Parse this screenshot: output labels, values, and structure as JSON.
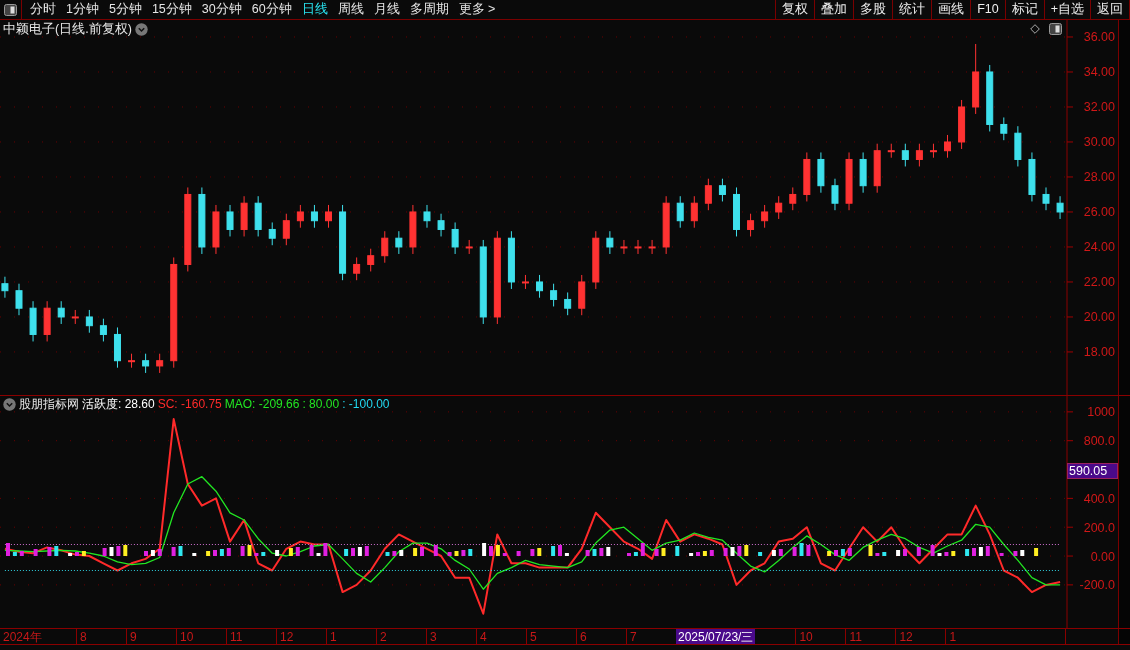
{
  "toolbar": {
    "periods": [
      {
        "label": "分时",
        "selected": false
      },
      {
        "label": "1分钟",
        "selected": false
      },
      {
        "label": "5分钟",
        "selected": false
      },
      {
        "label": "15分钟",
        "selected": false
      },
      {
        "label": "30分钟",
        "selected": false
      },
      {
        "label": "60分钟",
        "selected": false
      },
      {
        "label": "日线",
        "selected": true
      },
      {
        "label": "周线",
        "selected": false
      },
      {
        "label": "月线",
        "selected": false
      },
      {
        "label": "多周期",
        "selected": false
      },
      {
        "label": "更多 >",
        "selected": false
      }
    ],
    "actions": [
      "复权",
      "叠加",
      "多股",
      "统计",
      "画线",
      "F10",
      "标记",
      "+自选",
      "返回"
    ]
  },
  "price_panel": {
    "title": "中颖电子(日线.前复权)",
    "chart_data": {
      "type": "candlestick",
      "categories": [
        null,
        null,
        null,
        null,
        null,
        null,
        null,
        null,
        null,
        null,
        null,
        null,
        null,
        null,
        null,
        null,
        null,
        null,
        null,
        null,
        null,
        null,
        null,
        null,
        null,
        null,
        null,
        null,
        null,
        null,
        null,
        null,
        null,
        null,
        null,
        null,
        null,
        null,
        null,
        null,
        null,
        null,
        null,
        null,
        null,
        null,
        null,
        null,
        null,
        null,
        null,
        null,
        null,
        null,
        null,
        null,
        null,
        null,
        null,
        null,
        null,
        null,
        null,
        null,
        null,
        null,
        null,
        null,
        null,
        null,
        null,
        null,
        null,
        null,
        null,
        null
      ],
      "ohlc": [
        [
          21.9,
          22.3,
          21.1,
          21.5
        ],
        [
          21.5,
          21.9,
          20.1,
          20.5
        ],
        [
          20.5,
          20.9,
          18.6,
          19
        ],
        [
          19,
          20.9,
          18.6,
          20.5
        ],
        [
          20.5,
          20.9,
          19.6,
          20
        ],
        [
          20,
          20.4,
          19.6,
          20
        ],
        [
          20,
          20.4,
          19.1,
          19.5
        ],
        [
          19.5,
          19.9,
          18.6,
          19
        ],
        [
          19,
          19.4,
          17.1,
          17.5
        ],
        [
          17.5,
          17.9,
          17.1,
          17.5
        ],
        [
          17.5,
          17.9,
          16.8,
          17.2
        ],
        [
          17.2,
          17.9,
          16.8,
          17.5
        ],
        [
          17.5,
          23.4,
          17.1,
          23
        ],
        [
          23,
          27.4,
          22.6,
          27
        ],
        [
          27,
          27.4,
          23.6,
          24
        ],
        [
          24,
          26.4,
          23.6,
          26
        ],
        [
          26,
          26.4,
          24.6,
          25
        ],
        [
          25,
          26.9,
          24.6,
          26.5
        ],
        [
          26.5,
          26.9,
          24.6,
          25
        ],
        [
          25,
          25.4,
          24.1,
          24.5
        ],
        [
          24.5,
          25.9,
          24.1,
          25.5
        ],
        [
          25.5,
          26.4,
          25.1,
          26
        ],
        [
          26,
          26.4,
          25.1,
          25.5
        ],
        [
          25.5,
          26.4,
          25.1,
          26
        ],
        [
          26,
          26.4,
          22.1,
          22.5
        ],
        [
          22.5,
          23.4,
          22.1,
          23
        ],
        [
          23,
          23.9,
          22.6,
          23.5
        ],
        [
          23.5,
          24.9,
          23.1,
          24.5
        ],
        [
          24.5,
          24.9,
          23.6,
          24
        ],
        [
          24,
          26.4,
          23.6,
          26
        ],
        [
          26,
          26.4,
          25.1,
          25.5
        ],
        [
          25.5,
          25.9,
          24.6,
          25
        ],
        [
          25,
          25.4,
          23.6,
          24
        ],
        [
          24,
          24.4,
          23.6,
          24
        ],
        [
          24,
          24.4,
          19.6,
          20
        ],
        [
          20,
          24.9,
          19.6,
          24.5
        ],
        [
          24.5,
          24.9,
          21.6,
          22
        ],
        [
          22,
          22.4,
          21.6,
          22
        ],
        [
          22,
          22.4,
          21.1,
          21.5
        ],
        [
          21.5,
          21.9,
          20.6,
          21
        ],
        [
          21,
          21.4,
          20.1,
          20.5
        ],
        [
          20.5,
          22.4,
          20.1,
          22
        ],
        [
          22,
          24.9,
          21.6,
          24.5
        ],
        [
          24.5,
          24.9,
          23.6,
          24
        ],
        [
          24,
          24.4,
          23.6,
          24
        ],
        [
          24,
          24.4,
          23.6,
          24
        ],
        [
          24,
          24.4,
          23.6,
          24
        ],
        [
          24,
          26.9,
          23.6,
          26.5
        ],
        [
          26.5,
          26.9,
          25.1,
          25.5
        ],
        [
          25.5,
          26.9,
          25.1,
          26.5
        ],
        [
          26.5,
          27.9,
          26.1,
          27.5
        ],
        [
          27.5,
          27.9,
          26.6,
          27
        ],
        [
          27,
          27.4,
          24.6,
          25
        ],
        [
          25,
          25.9,
          24.6,
          25.5
        ],
        [
          25.5,
          26.4,
          25.1,
          26
        ],
        [
          26,
          26.9,
          25.6,
          26.5
        ],
        [
          26.5,
          27.4,
          26.1,
          27
        ],
        [
          27,
          29.4,
          26.6,
          29
        ],
        [
          29,
          29.4,
          27.1,
          27.5
        ],
        [
          27.5,
          27.9,
          26.1,
          26.5
        ],
        [
          26.5,
          29.4,
          26.1,
          29
        ],
        [
          29,
          29.4,
          27.1,
          27.5
        ],
        [
          27.5,
          29.9,
          27.1,
          29.5
        ],
        [
          29.5,
          29.9,
          29.1,
          29.5
        ],
        [
          29.5,
          29.9,
          28.6,
          29
        ],
        [
          29,
          29.9,
          28.6,
          29.5
        ],
        [
          29.5,
          29.9,
          29.1,
          29.5
        ],
        [
          29.5,
          30.4,
          29.1,
          30
        ],
        [
          30,
          32.4,
          29.6,
          32
        ],
        [
          32,
          35.6,
          31.6,
          34
        ],
        [
          34,
          34.4,
          30.6,
          31
        ],
        [
          31,
          31.4,
          30.1,
          30.5
        ],
        [
          30.5,
          30.9,
          28.6,
          29
        ],
        [
          29,
          29.4,
          26.6,
          27
        ],
        [
          27,
          27.4,
          26.1,
          26.5
        ],
        [
          26.5,
          26.9,
          25.6,
          26
        ]
      ],
      "ylim": [
        15.54,
        36.97
      ],
      "grid": true,
      "yticks": [
        {
          "value": 18,
          "label": "18.00"
        },
        {
          "value": 20,
          "label": "20.00"
        },
        {
          "value": 22,
          "label": "22.00"
        },
        {
          "value": 24,
          "label": "24.00"
        },
        {
          "value": 26,
          "label": "26.00"
        },
        {
          "value": 28,
          "label": "28.00"
        },
        {
          "value": 30,
          "label": "30.00"
        },
        {
          "value": 32,
          "label": "32.00"
        },
        {
          "value": 34,
          "label": "34.00"
        },
        {
          "value": 36,
          "label": "36.00"
        }
      ]
    }
  },
  "indicator_panel": {
    "name": "股朋指标网",
    "readouts": [
      {
        "text": "活跃度: 28.60",
        "color": "#ffffff"
      },
      {
        "text": "SC: -160.75",
        "color": "#ff2a2a"
      },
      {
        "text": "MAO: -209.66",
        "color": "#22e622"
      },
      {
        "text": ": 80.00",
        "color": "#22e622"
      },
      {
        "text": ": -100.00",
        "color": "#22d8f0"
      }
    ],
    "chart_data": {
      "type": "line",
      "categories": [
        null,
        null,
        null,
        null,
        null,
        null,
        null,
        null,
        null,
        null,
        null,
        null,
        null,
        null,
        null,
        null,
        null,
        null,
        null,
        null,
        null,
        null,
        null,
        null,
        null,
        null,
        null,
        null,
        null,
        null,
        null,
        null,
        null,
        null,
        null,
        null,
        null,
        null,
        null,
        null,
        null,
        null,
        null,
        null,
        null,
        null,
        null,
        null,
        null,
        null,
        null,
        null,
        null,
        null,
        null,
        null,
        null,
        null,
        null,
        null,
        null,
        null,
        null,
        null,
        null,
        null,
        null,
        null,
        null,
        null,
        null,
        null,
        null,
        null,
        null,
        null
      ],
      "series": [
        {
          "color": "#ff2a2a",
          "values": [
            50,
            30,
            20,
            60,
            40,
            10,
            0,
            -50,
            -100,
            -50,
            -20,
            50,
            950,
            500,
            350,
            400,
            100,
            250,
            -50,
            -100,
            50,
            100,
            80,
            80,
            -250,
            -200,
            -100,
            50,
            150,
            100,
            50,
            0,
            -150,
            -150,
            -400,
            150,
            -50,
            -50,
            -80,
            -80,
            -80,
            50,
            300,
            200,
            100,
            50,
            -20,
            250,
            100,
            150,
            120,
            80,
            -200,
            -100,
            -50,
            100,
            120,
            200,
            -50,
            -100,
            50,
            200,
            100,
            200,
            50,
            -50,
            50,
            150,
            150,
            350,
            150,
            -100,
            -150,
            -250,
            -200,
            -180
          ]
        },
        {
          "color": "#22e622",
          "values": [
            40,
            35,
            30,
            35,
            40,
            35,
            20,
            0,
            -40,
            -60,
            -50,
            -10,
            300,
            500,
            550,
            450,
            300,
            250,
            120,
            20,
            0,
            30,
            70,
            80,
            -20,
            -120,
            -180,
            -80,
            30,
            90,
            90,
            50,
            -30,
            -90,
            -230,
            -120,
            -80,
            -30,
            -60,
            -70,
            -80,
            -40,
            90,
            180,
            200,
            120,
            40,
            90,
            110,
            160,
            130,
            110,
            20,
            -70,
            -110,
            -30,
            60,
            140,
            80,
            10,
            -30,
            60,
            110,
            150,
            120,
            60,
            20,
            70,
            110,
            220,
            200,
            80,
            -30,
            -150,
            -200,
            -200
          ]
        },
        {
          "color": "#d070d0",
          "line_style": "dotted",
          "values": [
            80,
            80,
            80,
            80,
            80,
            80,
            80,
            80,
            80,
            80,
            80,
            80,
            80,
            80,
            80,
            80,
            80,
            80,
            80,
            80,
            80,
            80,
            80,
            80,
            80,
            80,
            80,
            80,
            80,
            80,
            80,
            80,
            80,
            80,
            80,
            80,
            80,
            80,
            80,
            80,
            80,
            80,
            80,
            80,
            80,
            80,
            80,
            80,
            80,
            80,
            80,
            80,
            80,
            80,
            80,
            80,
            80,
            80,
            80,
            80,
            80,
            80,
            80,
            80,
            80,
            80,
            80,
            80,
            80,
            80,
            80,
            80,
            80,
            80,
            80,
            80
          ]
        },
        {
          "color": "#30d0e0",
          "line_style": "dotted",
          "values": [
            -100,
            -100,
            -100,
            -100,
            -100,
            -100,
            -100,
            -100,
            -100,
            -100,
            -100,
            -100,
            -100,
            -100,
            -100,
            -100,
            -100,
            -100,
            -100,
            -100,
            -100,
            -100,
            -100,
            -100,
            -100,
            -100,
            -100,
            -100,
            -100,
            -100,
            -100,
            -100,
            -100,
            -100,
            -100,
            -100,
            -100,
            -100,
            -100,
            -100,
            -100,
            -100,
            -100,
            -100,
            -100,
            -100,
            -100,
            -100,
            -100,
            -100,
            -100,
            -100,
            -100,
            -100,
            -100,
            -100,
            -100,
            -100,
            -100,
            -100,
            -100,
            -100,
            -100,
            -100,
            -100,
            -100,
            -100,
            -100,
            -100,
            -100,
            -100,
            -100,
            -100,
            -100,
            -100,
            -100
          ]
        }
      ],
      "ylim": [
        -499,
        1110
      ],
      "yticks": [
        {
          "value": -200,
          "label": "-200.0"
        },
        {
          "value": 0,
          "label": "0.00"
        },
        {
          "value": 200,
          "label": "200.0"
        },
        {
          "value": 400,
          "label": "400.0"
        },
        {
          "value": 800,
          "label": "800.0"
        },
        {
          "value": 1000,
          "label": "1000"
        }
      ],
      "grid": true
    },
    "cursor_value": "590.05"
  },
  "time_axis": [
    {
      "label": "2024年",
      "selected": false
    },
    {
      "label": "8",
      "selected": false
    },
    {
      "label": "9",
      "selected": false
    },
    {
      "label": "10",
      "selected": false
    },
    {
      "label": "11",
      "selected": false
    },
    {
      "label": "12",
      "selected": false
    },
    {
      "label": "1",
      "selected": false
    },
    {
      "label": "2",
      "selected": false
    },
    {
      "label": "3",
      "selected": false
    },
    {
      "label": "4",
      "selected": false
    },
    {
      "label": "5",
      "selected": false
    },
    {
      "label": "6",
      "selected": false
    },
    {
      "label": "7",
      "selected": false
    },
    {
      "label": "2025/07/23/三",
      "selected": true
    },
    {
      "label": "10",
      "selected": false
    },
    {
      "label": "11",
      "selected": false
    },
    {
      "label": "12",
      "selected": false
    },
    {
      "label": "1",
      "selected": false
    }
  ]
}
